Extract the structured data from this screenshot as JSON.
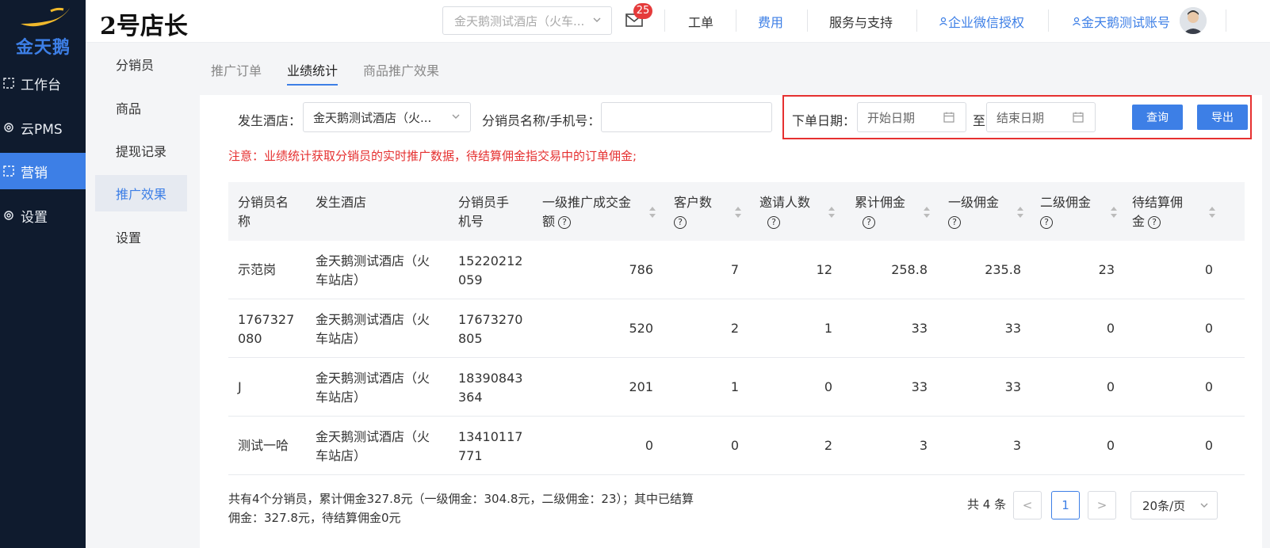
{
  "sidebar": {
    "logo_text": "金天鹅",
    "items": [
      {
        "label": "工作台",
        "icon": "dashboard-icon"
      },
      {
        "label": "云PMS",
        "icon": "gear-icon"
      },
      {
        "label": "营销",
        "icon": "marketing-icon",
        "active": true
      },
      {
        "label": "设置",
        "icon": "gear-icon"
      }
    ]
  },
  "header": {
    "brand": "2号店长",
    "hotel_select": "金天鹅测试酒店（火车...",
    "mail_badge": "25",
    "links": {
      "ticket": "工单",
      "fees": "费用",
      "support": "服务与支持",
      "wechat": "企业微信授权",
      "account": "金天鹅测试账号"
    }
  },
  "subnav": {
    "items": [
      {
        "label": "分销员"
      },
      {
        "label": "商品"
      },
      {
        "label": "提现记录"
      },
      {
        "label": "推广效果",
        "active": true
      },
      {
        "label": "设置"
      }
    ]
  },
  "tabs": [
    {
      "label": "推广订单"
    },
    {
      "label": "业绩统计",
      "active": true
    },
    {
      "label": "商品推广效果"
    }
  ],
  "filters": {
    "hotel_label": "发生酒店：",
    "hotel_value": "金天鹅测试酒店（火...",
    "agent_label": "分销员名称/手机号：",
    "agent_placeholder": "",
    "date_label": "下单日期：",
    "start_placeholder": "开始日期",
    "to": "至",
    "end_placeholder": "结束日期",
    "query_button": "查询",
    "export_button": "导出"
  },
  "notice": "注意：业绩统计获取分销员的实时推广数据，待结算佣金指交易中的订单佣金;",
  "table": {
    "columns": [
      {
        "line1": "分销员名",
        "line2": "称",
        "help": false,
        "sortable": false
      },
      {
        "line1": "发生酒店",
        "line2": "",
        "help": false,
        "sortable": false
      },
      {
        "line1": "分销员手",
        "line2": "机号",
        "help": false,
        "sortable": false
      },
      {
        "line1": "一级推广成交金",
        "line2": "额",
        "help": true,
        "sortable": true
      },
      {
        "line1": "客户数",
        "line2": "",
        "help": true,
        "sortable": true
      },
      {
        "line1": "邀请人数",
        "line2": "",
        "help": true,
        "sortable": true
      },
      {
        "line1": "累计佣金",
        "line2": "",
        "help": true,
        "sortable": true
      },
      {
        "line1": "一级佣金",
        "line2": "",
        "help": true,
        "sortable": true
      },
      {
        "line1": "二级佣金",
        "line2": "",
        "help": true,
        "sortable": true
      },
      {
        "line1": "待结算佣",
        "line2": "金",
        "help": true,
        "sortable": true
      }
    ],
    "rows": [
      {
        "name1": "示范岗",
        "name2": "",
        "hotel1": "金天鹅测试酒店（火",
        "hotel2": "车站店）",
        "phone1": "15220212",
        "phone2": "059",
        "amount": "786",
        "customers": "7",
        "invites": "12",
        "total": "258.8",
        "level1": "235.8",
        "level2": "23",
        "pending": "0"
      },
      {
        "name1": "1767327",
        "name2": "080",
        "hotel1": "金天鹅测试酒店（火",
        "hotel2": "车站店）",
        "phone1": "17673270",
        "phone2": "805",
        "amount": "520",
        "customers": "2",
        "invites": "1",
        "total": "33",
        "level1": "33",
        "level2": "0",
        "pending": "0"
      },
      {
        "name1": "J",
        "name2": "",
        "hotel1": "金天鹅测试酒店（火",
        "hotel2": "车站店）",
        "phone1": "18390843",
        "phone2": "364",
        "amount": "201",
        "customers": "1",
        "invites": "0",
        "total": "33",
        "level1": "33",
        "level2": "0",
        "pending": "0"
      },
      {
        "name1": "测试一哈",
        "name2": "",
        "hotel1": "金天鹅测试酒店（火",
        "hotel2": "车站店）",
        "phone1": "13410117",
        "phone2": "771",
        "amount": "0",
        "customers": "0",
        "invites": "2",
        "total": "3",
        "level1": "3",
        "level2": "0",
        "pending": "0"
      }
    ]
  },
  "summary": {
    "line1": "共有4个分销员，累计佣金327.8元（一级佣金：304.8元，二级佣金：23）；其中已结算",
    "line2": "佣金：327.8元，待结算佣金0元"
  },
  "pagination": {
    "total": "共 4 条",
    "prev": "<",
    "current": "1",
    "next": ">",
    "page_size": "20条/页"
  },
  "colors": {
    "accent": "#3d7fe6",
    "sidebar_bg": "#0f1b2e",
    "warning": "#e53030"
  }
}
